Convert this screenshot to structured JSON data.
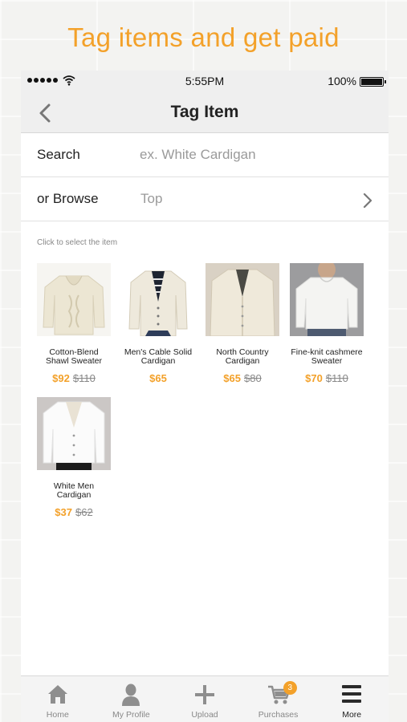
{
  "banner": {
    "text": "Tag items and get paid"
  },
  "status_bar": {
    "time": "5:55PM",
    "battery": "100%"
  },
  "nav": {
    "title": "Tag Item"
  },
  "search": {
    "label": "Search",
    "placeholder": "ex. White Cardigan"
  },
  "browse": {
    "label": "or Browse",
    "value": "Top"
  },
  "hint": "Click to select the item",
  "items": [
    {
      "name": "Cotton-Blend Shawl Sweater",
      "price": "$92",
      "old_price": "$110"
    },
    {
      "name": "Men's Cable Solid Cardigan",
      "price": "$65",
      "old_price": ""
    },
    {
      "name": "North Country Cardigan",
      "price": "$65",
      "old_price": "$80"
    },
    {
      "name": "Fine-knit cashmere Sweater",
      "price": "$70",
      "old_price": "$110"
    },
    {
      "name": "White Men Cardigan",
      "price": "$37",
      "old_price": "$62"
    }
  ],
  "tabs": [
    {
      "label": "Home",
      "icon": "home-icon"
    },
    {
      "label": "My Profile",
      "icon": "profile-icon"
    },
    {
      "label": "Upload",
      "icon": "plus-icon"
    },
    {
      "label": "Purchases",
      "icon": "cart-icon",
      "badge": "3"
    },
    {
      "label": "More",
      "icon": "menu-icon",
      "active": true
    }
  ],
  "colors": {
    "accent": "#f3a12a",
    "bar": "#efefef"
  }
}
